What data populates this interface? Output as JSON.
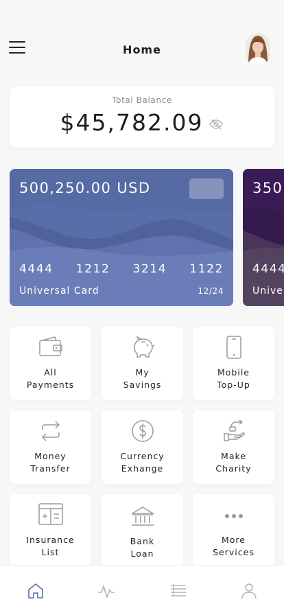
{
  "header": {
    "title": "Home"
  },
  "balance": {
    "label": "Total Balance",
    "amount": "$45,782.09"
  },
  "cards": [
    {
      "amount": "500,250.00 USD",
      "numbers": [
        "4444",
        "1212",
        "3214",
        "1122"
      ],
      "name": "Universal Card",
      "expiry": "12/24",
      "color": "#5a6ea8"
    },
    {
      "amount": "350,",
      "numbers": [
        "4444"
      ],
      "name": "Unive",
      "color": "#3a1d52"
    }
  ],
  "services": [
    {
      "label": "All\nPayments",
      "icon": "wallet-icon"
    },
    {
      "label": "My\nSavings",
      "icon": "piggy-bank-icon"
    },
    {
      "label": "Mobile\nTop-Up",
      "icon": "mobile-phone-icon"
    },
    {
      "label": "Money\nTransfer",
      "icon": "transfer-arrows-icon"
    },
    {
      "label": "Currency\nExhange",
      "icon": "dollar-coin-icon"
    },
    {
      "label": "Make\nCharity",
      "icon": "charity-hand-icon"
    },
    {
      "label": "Insurance\nList",
      "icon": "calculator-icon"
    },
    {
      "label": "Bank\nLoan",
      "icon": "bank-icon"
    },
    {
      "label": "More\nServices",
      "icon": "more-dots-icon"
    }
  ],
  "bottom_nav": [
    "home-icon",
    "activity-icon",
    "list-icon",
    "profile-icon"
  ],
  "colors": {
    "accent": "#5a6ea8",
    "icon_gray": "#9a9a9a"
  }
}
